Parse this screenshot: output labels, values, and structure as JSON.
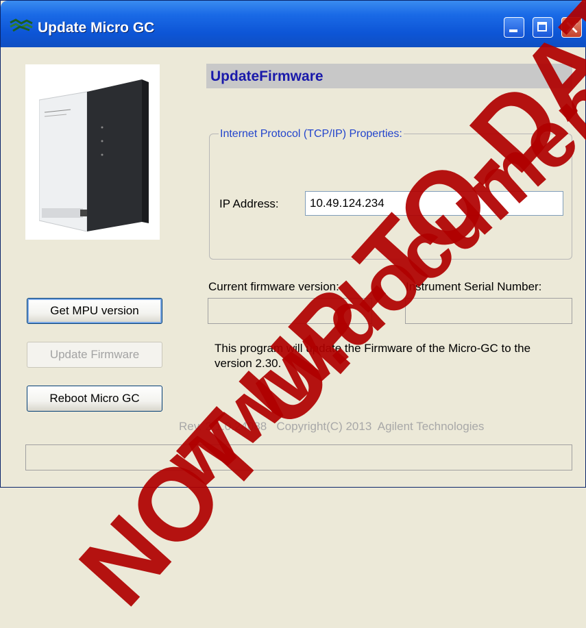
{
  "window": {
    "title": "Update Micro GC",
    "controls": {
      "minimize_icon": "minimize-icon",
      "maximize_icon": "maximize-icon",
      "close_icon": "close-icon"
    }
  },
  "header": {
    "title": "UpdateFirmware"
  },
  "tcpip_group": {
    "title": "Internet Protocol (TCP/IP) Properties:",
    "ip_label": "IP Address:",
    "ip_value": "10.49.124.234"
  },
  "firmware": {
    "current_label": "Current firmware version:",
    "current_value": "",
    "serial_label": "Instrument Serial Number:",
    "serial_value": ""
  },
  "buttons": {
    "get_mpu": "Get MPU version",
    "update_firmware": "Update Firmware",
    "reboot": "Reboot Micro GC"
  },
  "info_text": "This program will update the Firmware of the Micro-GC to the version 2.30.",
  "footer": {
    "revision": "Rev. 2.1.0.24088   Copyright(C) 2013  Agilent Technologies"
  },
  "status_bar": {
    "text": ""
  },
  "watermark": {
    "line1": "NOT UP-TO-DATE",
    "line2": "www.document"
  },
  "colors": {
    "title_bar": "#0d55d6",
    "header_text": "#1a1aaa",
    "group_title": "#2244cc",
    "window_bg": "#ece9d8",
    "watermark": "#b00000"
  }
}
